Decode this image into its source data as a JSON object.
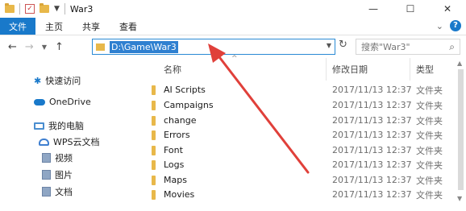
{
  "window": {
    "title": "War3",
    "minimize": "—",
    "maximize": "☐",
    "close": "✕"
  },
  "ribbon": {
    "tabs": [
      "文件",
      "主页",
      "共享",
      "查看"
    ],
    "expand": "⌄",
    "help": "?"
  },
  "address": {
    "path": "D:\\Game\\War3",
    "search_placeholder": "搜索\"War3\""
  },
  "sidebar": {
    "items": [
      {
        "label": "快速访问",
        "icon": "pin-icon"
      },
      {
        "label": "OneDrive",
        "icon": "cloud-icon"
      },
      {
        "label": "我的电脑",
        "icon": "computer-icon"
      },
      {
        "label": "WPS云文档",
        "icon": "wps-cloud-icon"
      },
      {
        "label": "视频",
        "icon": "video-library-icon"
      },
      {
        "label": "图片",
        "icon": "picture-library-icon"
      },
      {
        "label": "文档",
        "icon": "document-library-icon"
      }
    ]
  },
  "columns": {
    "name": "名称",
    "date": "修改日期",
    "type": "类型"
  },
  "files": [
    {
      "name": "AI Scripts",
      "date": "2017/11/13 12:37",
      "type": "文件夹"
    },
    {
      "name": "Campaigns",
      "date": "2017/11/13 12:37",
      "type": "文件夹"
    },
    {
      "name": "change",
      "date": "2017/11/13 12:37",
      "type": "文件夹"
    },
    {
      "name": "Errors",
      "date": "2017/11/13 12:37",
      "type": "文件夹"
    },
    {
      "name": "Font",
      "date": "2017/11/13 12:37",
      "type": "文件夹"
    },
    {
      "name": "Logs",
      "date": "2017/11/13 12:37",
      "type": "文件夹"
    },
    {
      "name": "Maps",
      "date": "2017/11/13 12:37",
      "type": "文件夹"
    },
    {
      "name": "Movies",
      "date": "2017/11/13 12:37",
      "type": "文件夹"
    }
  ],
  "colors": {
    "accent": "#1979ca",
    "folder": "#e8b84a",
    "annotation_arrow": "#e0403a"
  }
}
